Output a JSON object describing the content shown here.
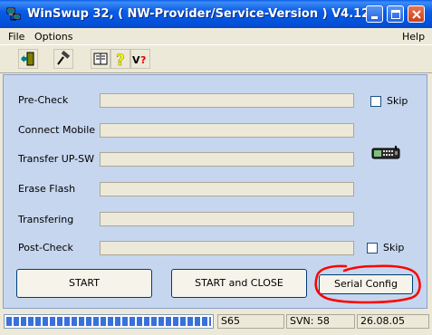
{
  "window": {
    "title": "WinSwup 32, ( NW-Provider/Service-Version ) V4.12",
    "app_icon": "pc-network-icon",
    "controls": [
      "minimize-icon",
      "maximize-icon",
      "close-icon"
    ]
  },
  "menu": {
    "file": "File",
    "options": "Options",
    "help": "Help"
  },
  "toolbar": {
    "tools": [
      "door-exit-icon",
      "hammer-icon",
      "book-icon",
      "help-question-icon",
      "version-query-icon"
    ],
    "version_icon_text": "V?"
  },
  "steps": [
    {
      "label": "Pre-Check"
    },
    {
      "label": "Connect Mobile"
    },
    {
      "label": "Transfer UP-SW"
    },
    {
      "label": "Erase Flash"
    },
    {
      "label": "Transfering"
    },
    {
      "label": "Post-Check"
    }
  ],
  "skip_precheck": {
    "label": "Skip",
    "checked": false
  },
  "skip_postcheck": {
    "label": "Skip",
    "checked": false
  },
  "phone_icon": "mobile-phone-icon",
  "buttons": {
    "start": "START",
    "start_close": "START and CLOSE",
    "serial_config": "Serial Config"
  },
  "annotation_color": "#ff0000",
  "status": {
    "progress": 1.0,
    "model": "S65",
    "svn": "SVN: 58",
    "date": "26.08.05"
  }
}
